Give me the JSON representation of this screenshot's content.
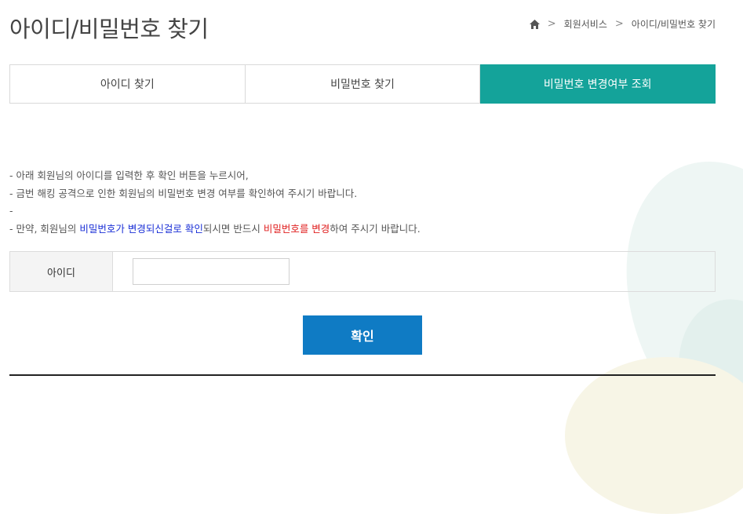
{
  "page": {
    "title": "아이디/비밀번호 찾기"
  },
  "breadcrumb": {
    "home_icon": "home-icon",
    "items": [
      "회원서비스",
      "아이디/비밀번호 찾기"
    ],
    "separator": ">"
  },
  "tabs": [
    {
      "label": "아이디 찾기",
      "active": false
    },
    {
      "label": "비밀번호 찾기",
      "active": false
    },
    {
      "label": "비밀번호 변경여부 조회",
      "active": true
    }
  ],
  "notice": {
    "line1": "- 아래 회원님의 아이디를 입력한 후 확인 버튼을 누르시어,",
    "line2": "- 금번 해킹 공격으로 인한 회원님의 비밀번호 변경 여부를 확인하여 주시기 바랍니다.",
    "line3": "-",
    "line4": {
      "prefix": "- 만약, 회원님의 ",
      "blue_text": "비밀번호가 변경되신걸로 확인",
      "middle": "되시면 반드시 ",
      "red_text": "비밀번호를 변경",
      "suffix": "하여 주시기 바랍니다."
    }
  },
  "form": {
    "id_label": "아이디",
    "id_value": "",
    "id_placeholder": ""
  },
  "buttons": {
    "confirm": "확인"
  },
  "colors": {
    "active_tab": "#14a39a",
    "confirm_button": "#0f7bc4",
    "highlight_blue": "#1a2fd6",
    "highlight_red": "#e02020"
  }
}
